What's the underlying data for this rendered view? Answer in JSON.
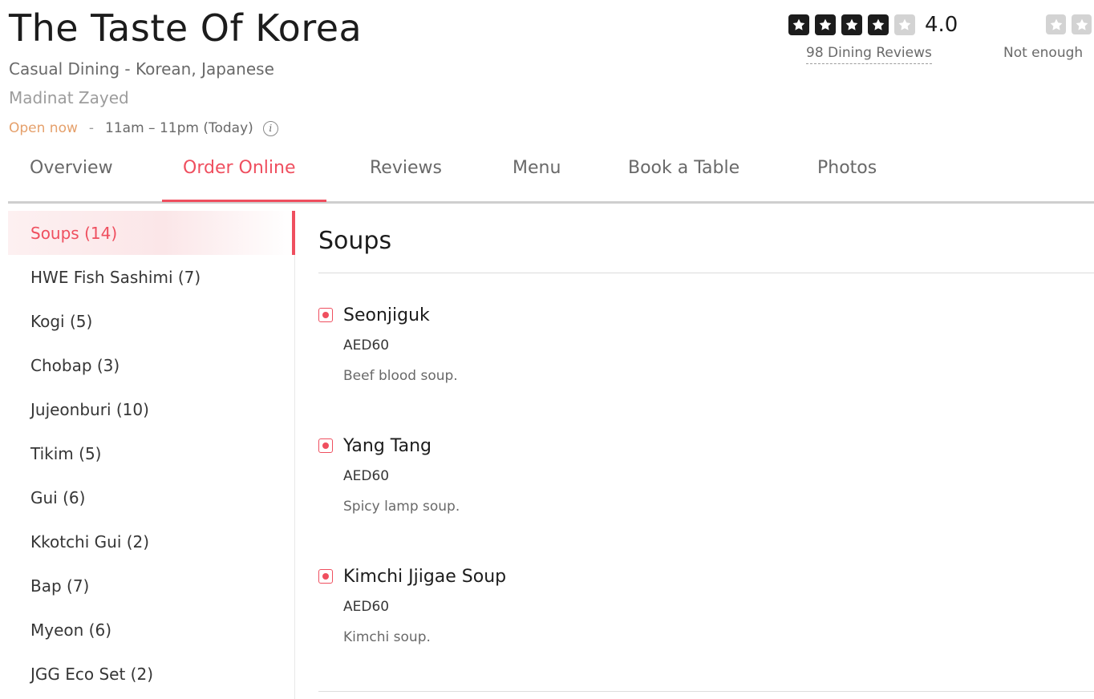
{
  "restaurant": {
    "name": "The Taste Of Korea",
    "cuisine": "Casual Dining - Korean, Japanese",
    "locality": "Madinat Zayed",
    "status": "Open now",
    "separator": "-",
    "hours": "11am – 11pm (Today)"
  },
  "dining_rating": {
    "value": "4.0",
    "stars_filled": 4,
    "stars_total": 5,
    "reviews_label": "98 Dining Reviews"
  },
  "delivery_rating": {
    "label": "Not enough"
  },
  "tabs": [
    {
      "label": "Overview",
      "active": false
    },
    {
      "label": "Order Online",
      "active": true
    },
    {
      "label": "Reviews",
      "active": false
    },
    {
      "label": "Menu",
      "active": false
    },
    {
      "label": "Book a Table",
      "active": false
    },
    {
      "label": "Photos",
      "active": false
    }
  ],
  "categories": [
    {
      "label": "Soups (14)",
      "active": true
    },
    {
      "label": "HWE Fish Sashimi (7)",
      "active": false
    },
    {
      "label": "Kogi (5)",
      "active": false
    },
    {
      "label": "Chobap (3)",
      "active": false
    },
    {
      "label": "Jujeonburi (10)",
      "active": false
    },
    {
      "label": "Tikim (5)",
      "active": false
    },
    {
      "label": "Gui (6)",
      "active": false
    },
    {
      "label": "Kkotchi Gui (2)",
      "active": false
    },
    {
      "label": "Bap (7)",
      "active": false
    },
    {
      "label": "Myeon (6)",
      "active": false
    },
    {
      "label": "JGG Eco Set (2)",
      "active": false
    }
  ],
  "section": {
    "title": "Soups",
    "items": [
      {
        "name": "Seonjiguk",
        "price": "AED60",
        "description": "Beef blood soup."
      },
      {
        "name": "Yang Tang",
        "price": "AED60",
        "description": "Spicy lamp soup."
      },
      {
        "name": "Kimchi Jjigae Soup",
        "price": "AED60",
        "description": "Kimchi soup."
      }
    ]
  },
  "colors": {
    "accent": "#ef4f5f",
    "open_status": "#e5a06b",
    "star_filled": "#1c1c1c",
    "star_empty": "#d3d3d3"
  }
}
